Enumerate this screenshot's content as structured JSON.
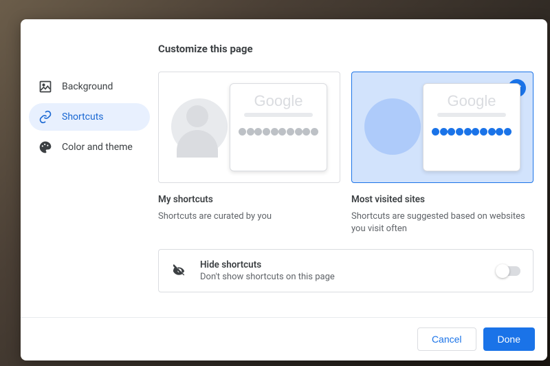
{
  "page_title": "Customize this page",
  "sidebar": {
    "items": [
      {
        "label": "Background"
      },
      {
        "label": "Shortcuts"
      },
      {
        "label": "Color and theme"
      }
    ],
    "active_index": 1
  },
  "options": {
    "my_shortcuts": {
      "title": "My shortcuts",
      "desc": "Shortcuts are curated by you",
      "selected": false,
      "mini_logo": "Google"
    },
    "most_visited": {
      "title": "Most visited sites",
      "desc": "Shortcuts are suggested based on websites you visit often",
      "selected": true,
      "mini_logo": "Google"
    }
  },
  "hide_shortcuts": {
    "title": "Hide shortcuts",
    "desc": "Don't show shortcuts on this page",
    "enabled": false
  },
  "footer": {
    "cancel": "Cancel",
    "done": "Done"
  },
  "colors": {
    "accent": "#1a73e8",
    "selected_bg": "#d2e3fc"
  }
}
